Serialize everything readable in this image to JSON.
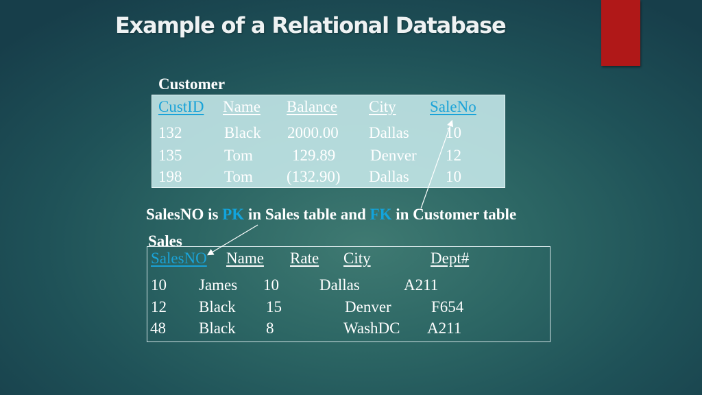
{
  "slide": {
    "title": "Example of a Relational Database",
    "accent_color": "#b01818",
    "highlight_color": "#12a4dc"
  },
  "customer": {
    "label": "Customer",
    "columns": [
      "CustID",
      "Name",
      "Balance",
      "City",
      "SaleNo"
    ],
    "key_columns": [
      "CustID",
      "SaleNo"
    ],
    "rows": [
      [
        "132",
        "Black",
        "2000.00",
        "Dallas",
        "10"
      ],
      [
        "135",
        "Tom",
        "129.89",
        "Denver",
        "12"
      ],
      [
        "198",
        "Tom",
        "(132.90)",
        "Dallas",
        "10"
      ]
    ]
  },
  "note": {
    "part1": "SalesNO is ",
    "pk": "PK",
    "part2": " in Sales table and ",
    "fk": "FK",
    "part3": " in Customer table"
  },
  "sales": {
    "label": "Sales",
    "columns": [
      "SalesNO",
      "Name",
      "Rate",
      "City",
      "Dept#"
    ],
    "key_columns": [
      "SalesNO"
    ],
    "rows": [
      [
        "10",
        "James",
        "10",
        "Dallas",
        "A211"
      ],
      [
        "12",
        "Black",
        "15",
        "Denver",
        "F654"
      ],
      [
        "48",
        "Black",
        "8",
        "WashDC",
        "A211"
      ]
    ]
  }
}
